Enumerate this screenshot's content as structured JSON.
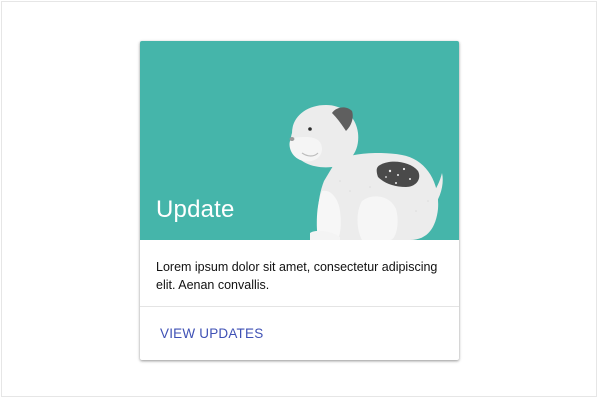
{
  "card": {
    "title": "Update",
    "supporting_text": "Lorem ipsum dolor sit amet,  consectetur adipiscing elit. Aenan convallis.",
    "action_label": "View Updates",
    "media_illustration": "dog-illustration",
    "colors": {
      "media_background": "#45b5aa",
      "title": "#ffffff",
      "action": "#3f51b5"
    }
  }
}
